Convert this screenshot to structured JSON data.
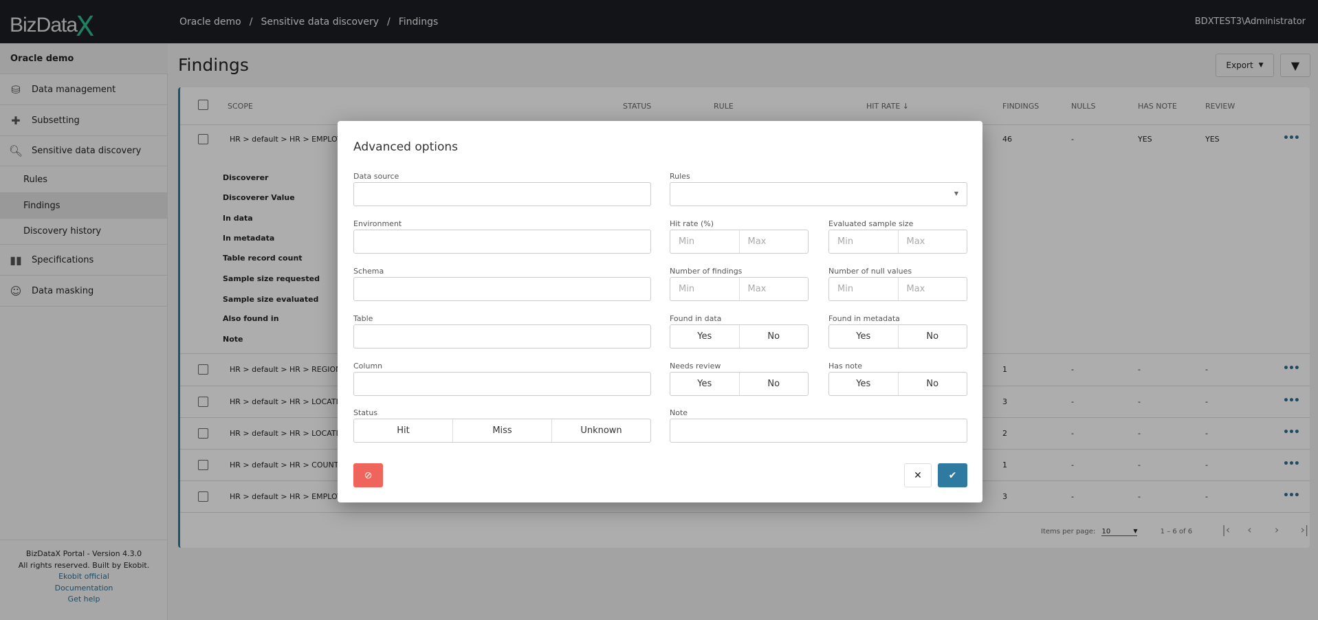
{
  "header": {
    "logo": "BizData",
    "logo_x": "X",
    "breadcrumb": [
      "Oracle demo",
      "Sensitive data discovery",
      "Findings"
    ],
    "user": "BDXTEST3\\Administrator"
  },
  "sidebar": {
    "project": "Oracle demo",
    "items": [
      {
        "label": "Data management",
        "icon": "database-icon"
      },
      {
        "label": "Subsetting",
        "icon": "puzzle-icon"
      },
      {
        "label": "Sensitive data discovery",
        "icon": "search-icon"
      },
      {
        "label": "Rules"
      },
      {
        "label": "Findings",
        "active": true
      },
      {
        "label": "Discovery history"
      },
      {
        "label": "Specifications",
        "icon": "book-icon"
      },
      {
        "label": "Data masking",
        "icon": "masks-icon"
      }
    ],
    "footer": {
      "version": "BizDataX Portal - Version 4.3.0",
      "rights": "All rights reserved. Built by Ekobit.",
      "links": [
        "Ekobit official",
        "Documentation",
        "Get help"
      ]
    }
  },
  "page": {
    "title": "Findings",
    "export_label": "Export"
  },
  "table": {
    "columns": [
      "SCOPE",
      "STATUS",
      "RULE",
      "HIT RATE",
      "FINDINGS",
      "NULLS",
      "HAS NOTE",
      "REVIEW"
    ],
    "rows": [
      {
        "scope": "HR > default > HR > EMPLOYEE",
        "findings": "46",
        "nulls": "-",
        "has_note": "YES",
        "review": "YES"
      },
      {
        "scope": "HR > default > HR > REGIONS >",
        "findings": "1",
        "nulls": "-",
        "has_note": "-",
        "review": "-"
      },
      {
        "scope": "HR > default > HR > LOCATION",
        "findings": "3",
        "nulls": "-",
        "has_note": "-",
        "review": "-"
      },
      {
        "scope": "HR > default > HR > LOCATION",
        "findings": "2",
        "nulls": "-",
        "has_note": "-",
        "review": "-"
      },
      {
        "scope": "HR > default > HR > COUNTRIE",
        "findings": "1",
        "nulls": "-",
        "has_note": "-",
        "review": "-"
      },
      {
        "scope": "HR > default > HR > EMPLOYEE",
        "findings": "3",
        "nulls": "-",
        "has_note": "-",
        "review": "-"
      }
    ],
    "details": [
      "Discoverer",
      "Discoverer Value",
      "In data",
      "In metadata",
      "Table record count",
      "Sample size requested",
      "Sample size evaluated",
      "Also found in",
      "Note"
    ],
    "pagination": {
      "items_label": "Items per page:",
      "per_page": "10",
      "range": "1 – 6 of 6"
    }
  },
  "dialog": {
    "title": "Advanced options",
    "labels": {
      "data_source": "Data source",
      "environment": "Environment",
      "schema": "Schema",
      "table": "Table",
      "column": "Column",
      "status": "Status",
      "rules": "Rules",
      "hit_rate": "Hit rate (%)",
      "sample": "Evaluated sample size",
      "findings": "Number of findings",
      "nulls": "Number of null values",
      "found_data": "Found in data",
      "found_meta": "Found in metadata",
      "needs_review": "Needs review",
      "has_note": "Has note",
      "note": "Note"
    },
    "min": "Min",
    "max": "Max",
    "yes": "Yes",
    "no": "No",
    "status_options": [
      "Hit",
      "Miss",
      "Unknown"
    ],
    "colors": {
      "clear": "#f0655b",
      "apply": "#2f7aa0"
    }
  }
}
